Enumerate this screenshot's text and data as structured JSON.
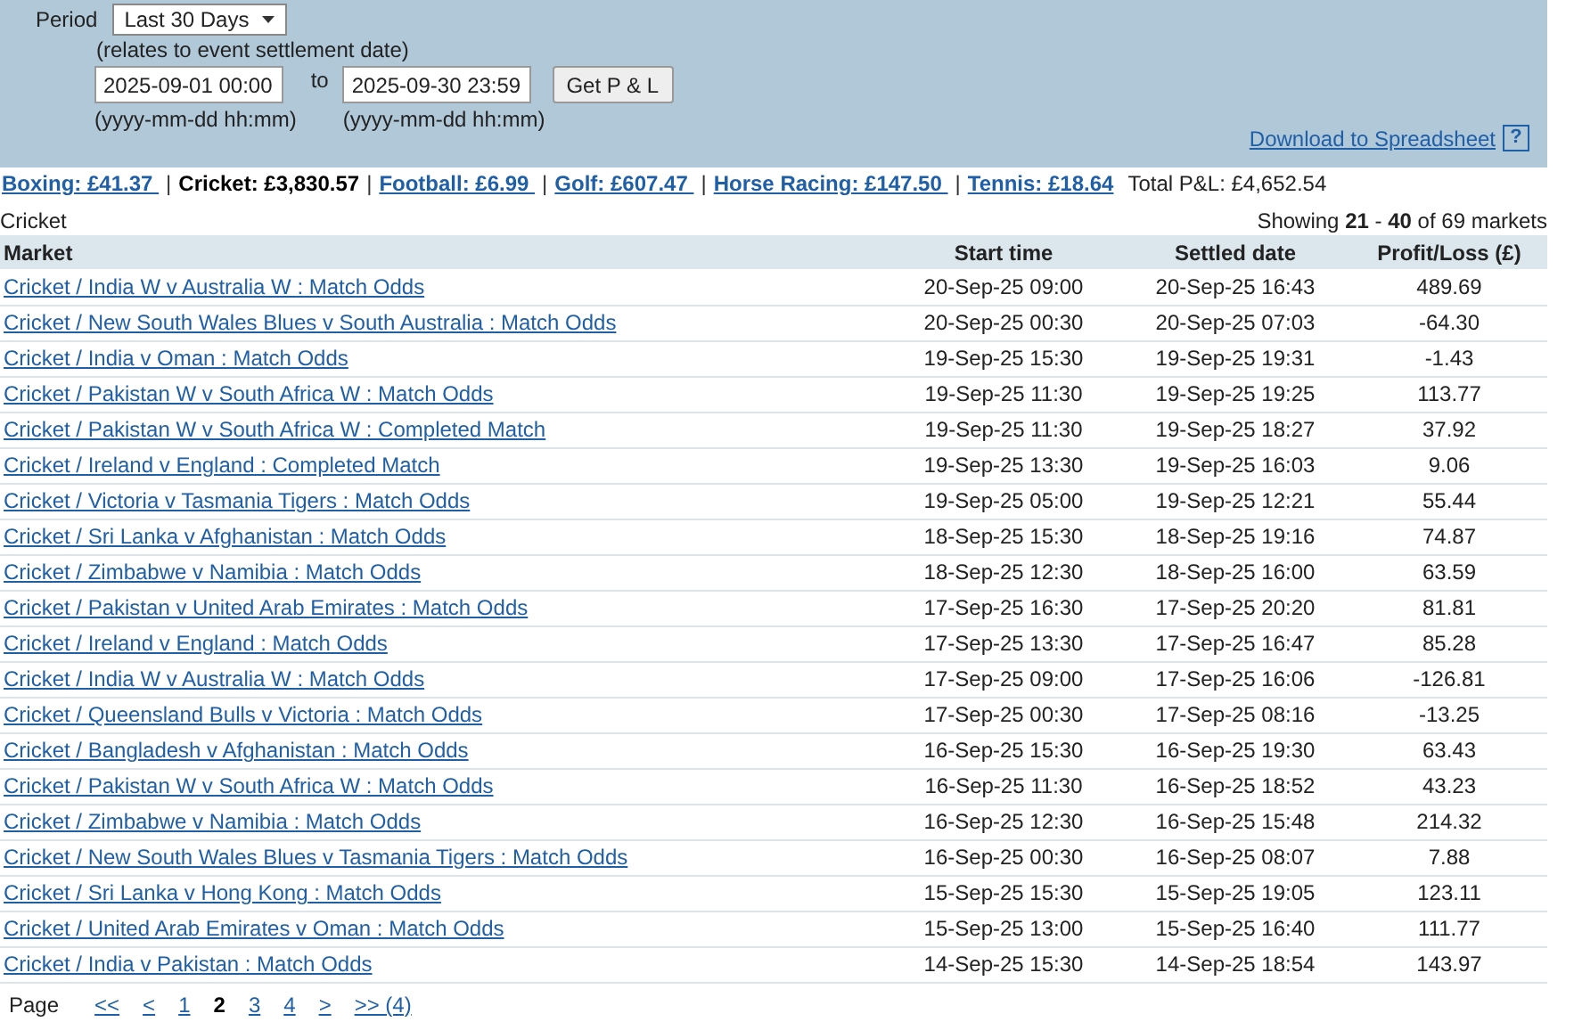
{
  "filter": {
    "period_label": "Period",
    "period_value": "Last 30 Days",
    "note": "(relates to event settlement date)",
    "from": "2025-09-01 00:00",
    "to_label": "to",
    "to": "2025-09-30 23:59",
    "format_hint_from": "(yyyy-mm-dd hh:mm)",
    "format_hint_to": "(yyyy-mm-dd hh:mm)",
    "button": "Get P & L",
    "download": "Download to Spreadsheet",
    "help": "?"
  },
  "sports": [
    {
      "label": "Boxing: £41.37 ",
      "selected": false
    },
    {
      "label": "Cricket: £3,830.57",
      "selected": true
    },
    {
      "label": "Football: £6.99 ",
      "selected": false
    },
    {
      "label": "Golf: £607.47 ",
      "selected": false
    },
    {
      "label": "Horse Racing: £147.50 ",
      "selected": false
    },
    {
      "label": "Tennis: £18.64",
      "selected": false
    }
  ],
  "sport_separator": "|",
  "total": "Total P&L: £4,652.54",
  "section_title": "Cricket",
  "showing": "Showing **21** - **40** of 69 markets",
  "table": {
    "columns": [
      "Market",
      "Start time",
      "Settled date",
      "Profit/Loss (£)"
    ],
    "rows": [
      [
        "Cricket / India W v Australia W : Match Odds",
        "20-Sep-25 09:00",
        "20-Sep-25 16:43",
        "489.69"
      ],
      [
        "Cricket / New South Wales Blues v South Australia : Match Odds",
        "20-Sep-25 00:30",
        "20-Sep-25 07:03",
        "-64.30"
      ],
      [
        "Cricket / India v Oman : Match Odds",
        "19-Sep-25 15:30",
        "19-Sep-25 19:31",
        "-1.43"
      ],
      [
        "Cricket / Pakistan W v South Africa W : Match Odds",
        "19-Sep-25 11:30",
        "19-Sep-25 19:25",
        "113.77"
      ],
      [
        "Cricket / Pakistan W v South Africa W : Completed Match",
        "19-Sep-25 11:30",
        "19-Sep-25 18:27",
        "37.92"
      ],
      [
        "Cricket / Ireland v England : Completed Match",
        "19-Sep-25 13:30",
        "19-Sep-25 16:03",
        "9.06"
      ],
      [
        "Cricket / Victoria v Tasmania Tigers : Match Odds",
        "19-Sep-25 05:00",
        "19-Sep-25 12:21",
        "55.44"
      ],
      [
        "Cricket / Sri Lanka v Afghanistan : Match Odds",
        "18-Sep-25 15:30",
        "18-Sep-25 19:16",
        "74.87"
      ],
      [
        "Cricket / Zimbabwe v Namibia : Match Odds",
        "18-Sep-25 12:30",
        "18-Sep-25 16:00",
        "63.59"
      ],
      [
        "Cricket / Pakistan v United Arab Emirates : Match Odds",
        "17-Sep-25 16:30",
        "17-Sep-25 20:20",
        "81.81"
      ],
      [
        "Cricket / Ireland v England : Match Odds",
        "17-Sep-25 13:30",
        "17-Sep-25 16:47",
        "85.28"
      ],
      [
        "Cricket / India W v Australia W : Match Odds",
        "17-Sep-25 09:00",
        "17-Sep-25 16:06",
        "-126.81"
      ],
      [
        "Cricket / Queensland Bulls v Victoria : Match Odds",
        "17-Sep-25 00:30",
        "17-Sep-25 08:16",
        "-13.25"
      ],
      [
        "Cricket / Bangladesh v Afghanistan : Match Odds",
        "16-Sep-25 15:30",
        "16-Sep-25 19:30",
        "63.43"
      ],
      [
        "Cricket / Pakistan W v South Africa W : Match Odds",
        "16-Sep-25 11:30",
        "16-Sep-25 18:52",
        "43.23"
      ],
      [
        "Cricket / Zimbabwe v Namibia : Match Odds",
        "16-Sep-25 12:30",
        "16-Sep-25 15:48",
        "214.32"
      ],
      [
        "Cricket / New South Wales Blues v Tasmania Tigers : Match Odds",
        "16-Sep-25 00:30",
        "16-Sep-25 08:07",
        "7.88"
      ],
      [
        "Cricket / Sri Lanka v Hong Kong : Match Odds",
        "15-Sep-25 15:30",
        "15-Sep-25 19:05",
        "123.11"
      ],
      [
        "Cricket / United Arab Emirates v Oman : Match Odds",
        "15-Sep-25 13:00",
        "15-Sep-25 16:40",
        "111.77"
      ],
      [
        "Cricket / India v Pakistan : Match Odds",
        "14-Sep-25 15:30",
        "14-Sep-25 18:54",
        "143.97"
      ]
    ]
  },
  "pager": {
    "label": "Page",
    "items": [
      {
        "label": "<<",
        "selected": false
      },
      {
        "label": "<",
        "selected": false
      },
      {
        "label": "1",
        "selected": false
      },
      {
        "label": "2",
        "selected": true
      },
      {
        "label": "3",
        "selected": false
      },
      {
        "label": "4",
        "selected": false
      },
      {
        "label": ">",
        "selected": false
      },
      {
        "label": ">> (4)",
        "selected": false
      }
    ]
  }
}
